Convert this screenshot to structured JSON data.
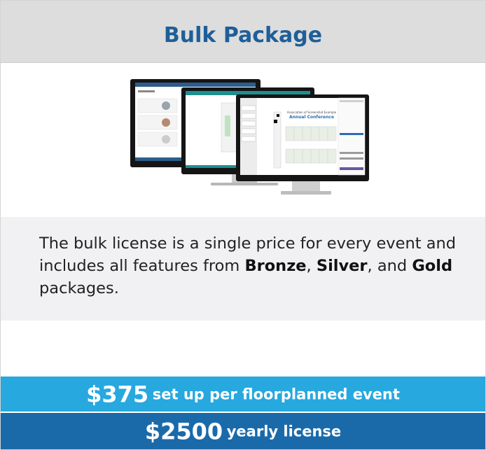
{
  "card": {
    "title": "Bulk Package",
    "description": {
      "part1": "The bulk license is a single price for every event and includes all features from ",
      "bronze": "Bronze",
      "sep1": ", ",
      "silver": "Silver",
      "sep2": ", and ",
      "gold": "Gold",
      "part2": " packages."
    },
    "pricing": [
      {
        "amount": "$375",
        "label": "set up per floorplanned event"
      },
      {
        "amount": "$2500",
        "label": "yearly license"
      }
    ],
    "screen_text": {
      "line1": "Association of Screenshot Example",
      "line2": "Annual Conference"
    },
    "colors": {
      "title": "#1e5f98",
      "price_primary": "#27a8df",
      "price_secondary": "#1a6aaa"
    }
  }
}
